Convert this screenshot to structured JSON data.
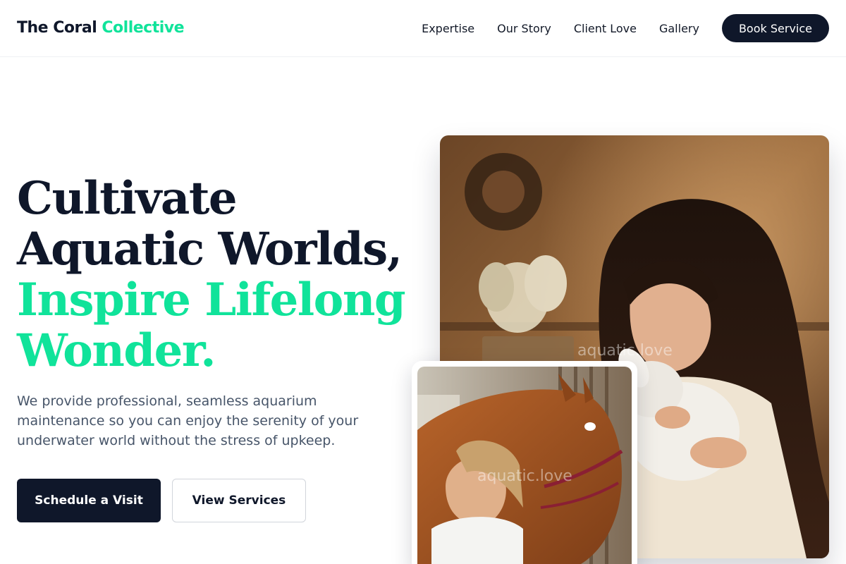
{
  "brand": {
    "part1": "The Coral ",
    "part2": "Collective"
  },
  "nav": {
    "links": [
      "Expertise",
      "Our Story",
      "Client Love",
      "Gallery"
    ],
    "book_label": "Book Service"
  },
  "hero": {
    "headline_line1": "Cultivate",
    "headline_line2": "Aquatic Worlds,",
    "headline_line3": "Inspire Lifelong",
    "headline_line4": "Wonder.",
    "lead": "We provide professional, seamless aquarium maintenance so you can enjoy the serenity of your underwater world without the stress of upkeep.",
    "primary_cta": "Schedule a Visit",
    "secondary_cta": "View Services"
  },
  "images": {
    "main_watermark": "aquatic.love",
    "small_watermark": "aquatic.love"
  },
  "colors": {
    "accent": "#10e39a",
    "dark": "#0f172a",
    "muted": "#475569"
  }
}
